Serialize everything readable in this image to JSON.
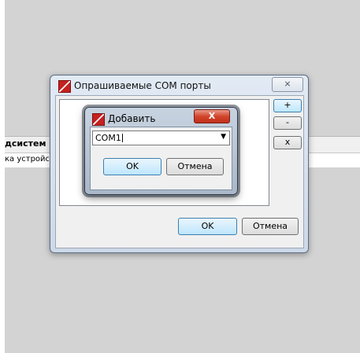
{
  "background": {
    "column_header": "дсистем",
    "row_text": "ка устройст"
  },
  "main_dialog": {
    "title": "Опрашиваемые COM порты",
    "close_glyph": "⨯",
    "add_button": "+",
    "minus_button": "-",
    "remove_button": "x",
    "ok_label": "OK",
    "cancel_label": "Отмена"
  },
  "add_dialog": {
    "title": "Добавить",
    "close_glyph": "X",
    "combo_value": "COM1",
    "combo_arrow": "▼",
    "ok_label": "OK",
    "cancel_label": "Отмена"
  },
  "colors": {
    "close_button_red": "#c0301a",
    "focus_blue": "#3c7fb1",
    "app_icon_red": "#c62020"
  },
  "icons": [
    "app-icon",
    "close-icon",
    "dropdown-arrow-icon"
  ]
}
